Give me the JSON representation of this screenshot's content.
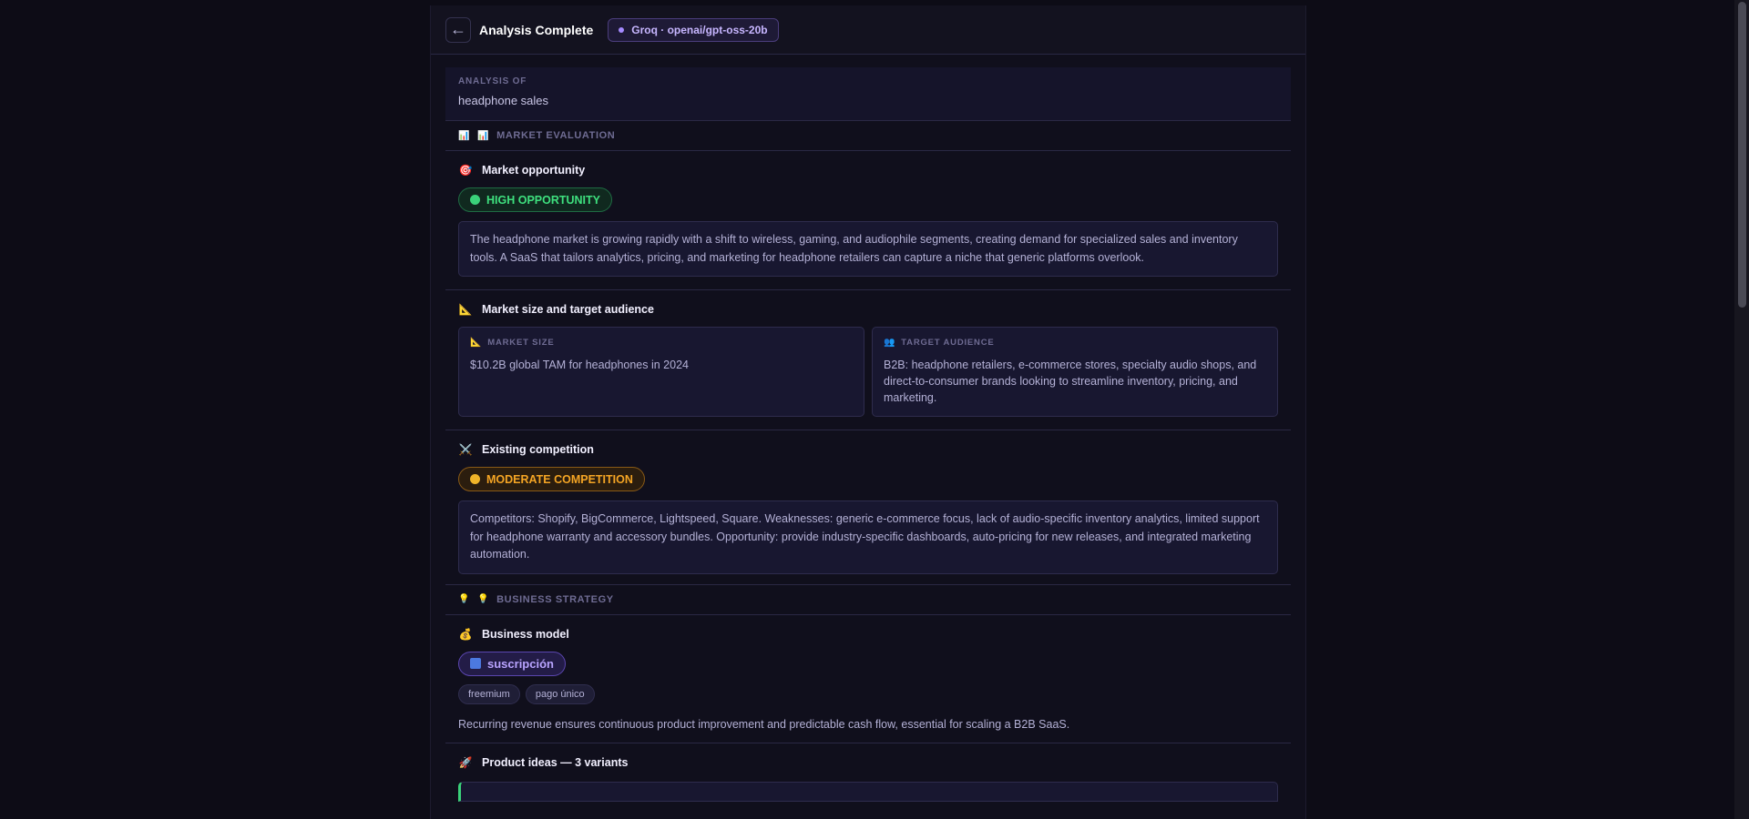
{
  "header": {
    "back_icon": "←",
    "title": "Analysis Complete",
    "model": "Groq · openai/gpt-oss-20b"
  },
  "analysis": {
    "label": "ANALYSIS OF",
    "value": "headphone sales"
  },
  "sections": {
    "market_evaluation": {
      "icon1": "📊",
      "icon2": "📊",
      "label": "MARKET EVALUATION"
    },
    "business_strategy": {
      "icon1": "💡",
      "icon2": "💡",
      "label": "BUSINESS STRATEGY"
    }
  },
  "opportunity": {
    "icon": "🎯",
    "title": "Market opportunity",
    "badge": "HIGH OPPORTUNITY",
    "text": "The headphone market is growing rapidly with a shift to wireless, gaming, and audiophile segments, creating demand for specialized sales and inventory tools. A SaaS that tailors analytics, pricing, and marketing for headphone retailers can capture a niche that generic platforms overlook."
  },
  "market_size": {
    "icon": "📐",
    "title": "Market size and target audience",
    "size_icon": "📐",
    "size_label": "MARKET SIZE",
    "size_value": "$10.2B global TAM for headphones in 2024",
    "audience_icon": "👥",
    "audience_label": "TARGET AUDIENCE",
    "audience_value": "B2B: headphone retailers, e-commerce stores, specialty audio shops, and direct-to-consumer brands looking to streamline inventory, pricing, and marketing."
  },
  "competition": {
    "icon": "⚔️",
    "title": "Existing competition",
    "badge": "MODERATE COMPETITION",
    "text": "Competitors: Shopify, BigCommerce, Lightspeed, Square. Weaknesses: generic e-commerce focus, lack of audio-specific inventory analytics, limited support for headphone warranty and accessory bundles. Opportunity: provide industry-specific dashboards, auto-pricing for new releases, and integrated marketing automation."
  },
  "business_model": {
    "icon": "💰",
    "title": "Business model",
    "badge_icon": "🔄",
    "badge": "suscripción",
    "chips": [
      "freemium",
      "pago único"
    ],
    "text": "Recurring revenue ensures continuous product improvement and predictable cash flow, essential for scaling a B2B SaaS."
  },
  "product_ideas": {
    "icon": "🚀",
    "title": "Product ideas — 3 variants"
  },
  "colors": {
    "accent": "#a58bff",
    "high": "#3ee07e",
    "moderate": "#f5a524"
  }
}
